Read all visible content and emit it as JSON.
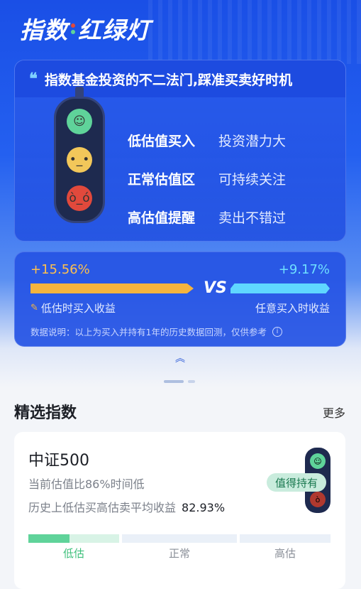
{
  "brand": {
    "part1": "指数",
    "part2": "红绿灯"
  },
  "intro": {
    "title": "指数基金投资的不二法门,踩准买卖好时机",
    "rules": [
      {
        "key": "低估值买入",
        "value": "投资潜力大"
      },
      {
        "key": "正常估值区",
        "value": "可持续关注"
      },
      {
        "key": "高估值提醒",
        "value": "卖出不错过"
      }
    ]
  },
  "compare": {
    "left_pct": "+15.56%",
    "right_pct": "+9.17%",
    "vs": "VS",
    "left_label": "低估时买入收益",
    "right_label": "任意买入时收益",
    "note": "数据说明：以上为买入并持有1年的历史数据回测，仅供参考"
  },
  "section": {
    "title": "精选指数",
    "more": "更多"
  },
  "fund": {
    "name": "中证500",
    "line1": "当前估值比86%时间低",
    "line2_label": "历史上低估买高估卖平均收益",
    "line2_value": "82.93%",
    "badge": "值得持有",
    "segments": [
      "低估",
      "正常",
      "高估"
    ],
    "low_fill": 0.45
  },
  "colors": {
    "green": "#5fd39a",
    "yellow": "#f2c75a",
    "red": "#e1493c",
    "low_active": "#5fd39a",
    "low_track": "#d8f3e6",
    "track": "#eaf0f8"
  },
  "icons": [
    "quote-icon",
    "pen-icon",
    "info-icon",
    "chevron-up-icon"
  ]
}
